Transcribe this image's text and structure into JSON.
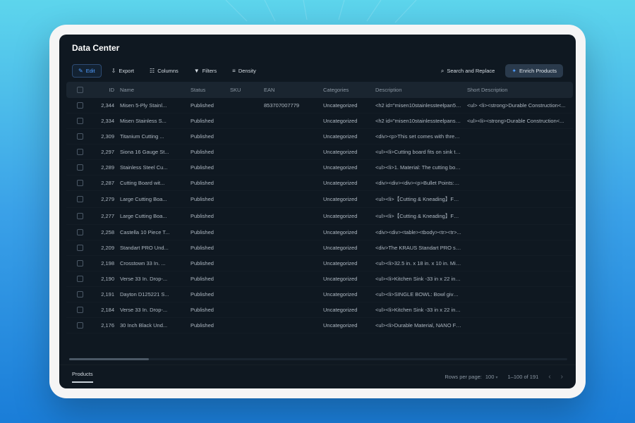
{
  "page": {
    "title": "Data Center"
  },
  "toolbar": {
    "edit": "Edit",
    "export": "Export",
    "columns": "Columns",
    "filters": "Filters",
    "density": "Density",
    "search_replace": "Search and Replace",
    "enrich": "Enrich Products"
  },
  "table": {
    "headers": {
      "id": "ID",
      "name": "Name",
      "status": "Status",
      "sku": "SKU",
      "ean": "EAN",
      "categories": "Categories",
      "description": "Description",
      "short_description": "Short Description"
    },
    "rows": [
      {
        "id": "2,344",
        "name": "Misen 5-Ply Stainl...",
        "status": "Published",
        "sku": "",
        "ean": "853707007779",
        "categories": "Uncategorized",
        "description": "<h2 id=\"misen10stainlessteelpan5plysta...",
        "short_description": "<ul> <li><strong>Durable Construction<..."
      },
      {
        "id": "2,334",
        "name": "Misen Stainless S...",
        "status": "Published",
        "sku": "",
        "ean": "",
        "categories": "Uncategorized",
        "description": "<h2 id=\"misen10stainlessteelpanstainle...",
        "short_description": "<ul><li><strong>Durable Construction<..."
      },
      {
        "id": "2,309",
        "name": "Titanium Cutting ...",
        "status": "Published",
        "sku": "",
        "ean": "",
        "categories": "Uncategorized",
        "description": "<div><p>This set comes with three differ...",
        "short_description": ""
      },
      {
        "id": "2,297",
        "name": "Siona 16 Gauge St...",
        "status": "Published",
        "sku": "",
        "ean": "",
        "categories": "Uncategorized",
        "description": "<ul><li>Cutting board fits on sink top for ...",
        "short_description": ""
      },
      {
        "id": "2,289",
        "name": "Stainless Steel Cu...",
        "status": "Published",
        "sku": "",
        "ean": "",
        "categories": "Uncategorized",
        "description": "<ul><li>1. Material: The cutting board is ...",
        "short_description": ""
      },
      {
        "id": "2,287",
        "name": "Cutting Board wit...",
        "status": "Published",
        "sku": "",
        "ean": "",
        "categories": "Uncategorized",
        "description": "<div><div><div><p>Bullet Points:</p><...",
        "short_description": ""
      },
      {
        "id": "2,279",
        "name": "Large Cutting Boa...",
        "status": "Published",
        "sku": "",
        "ean": "",
        "categories": "Uncategorized",
        "description": "<ul><li>【Cutting &amp; Kneading】For ...",
        "short_description": ""
      },
      {
        "id": "2,277",
        "name": "Large Cutting Boa...",
        "status": "Published",
        "sku": "",
        "ean": "",
        "categories": "Uncategorized",
        "description": "<ul><li>【Cutting &amp; Kneading】For ...",
        "short_description": ""
      },
      {
        "id": "2,258",
        "name": "Castella 10 Piece T...",
        "status": "Published",
        "sku": "",
        "ean": "",
        "categories": "Uncategorized",
        "description": "<div><div><table><tbody><tr><tr>...",
        "short_description": ""
      },
      {
        "id": "2,209",
        "name": "Standart PRO Und...",
        "status": "Published",
        "sku": "",
        "ean": "",
        "categories": "Uncategorized",
        "description": "<div>The KRAUS Standart PRO stainless...",
        "short_description": ""
      },
      {
        "id": "2,198",
        "name": "Crosstown 33 In. ...",
        "status": "Published",
        "sku": "",
        "ean": "",
        "categories": "Uncategorized",
        "description": "<ul><li>32.5 in. x 18 in. x 10 in. Minimum ...",
        "short_description": ""
      },
      {
        "id": "2,190",
        "name": "Verse 33 In. Drop-...",
        "status": "Published",
        "sku": "",
        "ean": "",
        "categories": "Uncategorized",
        "description": "<ul><li>Kitchen Sink -33 in x 22 in x 9-5/...",
        "short_description": ""
      },
      {
        "id": "2,191",
        "name": "Dayton D125221 S...",
        "status": "Published",
        "sku": "",
        "ean": "",
        "categories": "Uncategorized",
        "description": "<ul><li>SINGLE BOWL: Bowl gives you u...",
        "short_description": ""
      },
      {
        "id": "2,184",
        "name": "Verse 33 In. Drop-...",
        "status": "Published",
        "sku": "",
        "ean": "",
        "categories": "Uncategorized",
        "description": "<ul><li>Kitchen Sink -33 in x 22 in x 9-1/...",
        "short_description": ""
      },
      {
        "id": "2,176",
        "name": "30 Inch Black Und...",
        "status": "Published",
        "sku": "",
        "ean": "",
        "categories": "Uncategorized",
        "description": "<ul><li>Durable Material, NANO Feature...",
        "short_description": ""
      }
    ]
  },
  "footer": {
    "tab": "Products",
    "rows_label": "Rows per page:",
    "page_size": "100",
    "range": "1–100 of 191"
  }
}
